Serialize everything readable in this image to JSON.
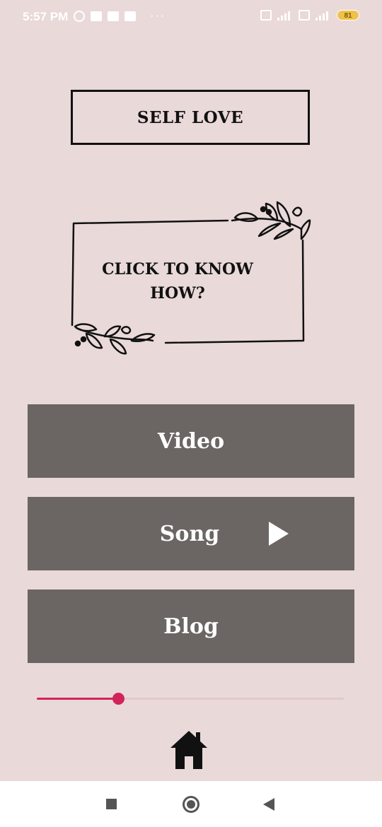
{
  "status_bar": {
    "time": "5:57 PM",
    "dots": "···",
    "battery": "81",
    "left_icons": [
      "alarm-icon",
      "message-icon",
      "message-icon",
      "message-icon"
    ],
    "right_icons": [
      "volte-icon",
      "signal-icon",
      "volte-icon",
      "signal-icon",
      "battery-icon"
    ]
  },
  "title": "SELF LOVE",
  "frame_text_line1": "CLICK TO KNOW",
  "frame_text_line2": "HOW?",
  "buttons": {
    "video": "Video",
    "song": "Song",
    "blog": "Blog"
  },
  "slider": {
    "value_fraction": 0.266,
    "fill_color": "#d2245a",
    "track_color": "#e2c8cc"
  },
  "colors": {
    "background": "#ead9d9",
    "button": "#6b6663",
    "text": "#111111"
  },
  "nav": {
    "icons": [
      "recent-apps-icon",
      "home-circle-icon",
      "back-icon"
    ]
  }
}
